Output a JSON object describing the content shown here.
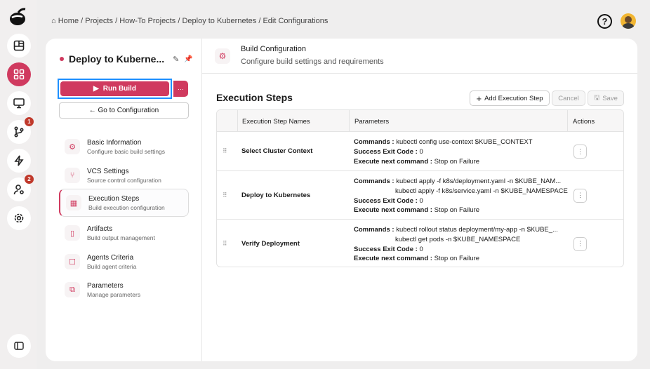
{
  "breadcrumb": {
    "items": [
      "Home",
      "Projects",
      "How-To Projects",
      "Deploy to Kubernetes",
      "Edit Configurations"
    ],
    "separator": "/"
  },
  "rail": {
    "badges": {
      "vcs": "1",
      "users": "2"
    }
  },
  "project": {
    "title": "Deploy to Kuberne...",
    "run_label": "Run Build",
    "more_label": "···",
    "goto_label": "← Go to Configuration"
  },
  "nav": [
    {
      "title": "Basic Information",
      "subtitle": "Configure basic build settings",
      "icon": "gear-icon"
    },
    {
      "title": "VCS Settings",
      "subtitle": "Source control configuration",
      "icon": "branch-icon"
    },
    {
      "title": "Execution Steps",
      "subtitle": "Build execution configuration",
      "icon": "blocks-icon",
      "active": true
    },
    {
      "title": "Artifacts",
      "subtitle": "Build output management",
      "icon": "file-icon"
    },
    {
      "title": "Agents Criteria",
      "subtitle": "Build agent criteria",
      "icon": "agent-icon"
    },
    {
      "title": "Parameters",
      "subtitle": "Manage parameters",
      "icon": "sliders-icon"
    }
  ],
  "header": {
    "title": "Build Configuration",
    "subtitle": "Configure build settings and requirements"
  },
  "section": {
    "title": "Execution Steps",
    "add_label": "Add Execution Step",
    "cancel_label": "Cancel",
    "save_label": "Save"
  },
  "table": {
    "columns": [
      "Execution Step Names",
      "Parameters",
      "Actions"
    ],
    "labels": {
      "commands": "Commands :",
      "exit": "Success Exit Code :",
      "next": "Execute next command :"
    },
    "rows": [
      {
        "name": "Select Cluster Context",
        "commands": [
          "kubectl config use-context $KUBE_CONTEXT"
        ],
        "exit_code": "0",
        "next": "Stop on Failure"
      },
      {
        "name": "Deploy to Kubernetes",
        "commands": [
          "kubectl apply -f k8s/deployment.yaml -n $KUBE_NAM...",
          "kubectl apply -f k8s/service.yaml -n $KUBE_NAMESPACE"
        ],
        "exit_code": "0",
        "next": "Stop on Failure"
      },
      {
        "name": "Verify Deployment",
        "commands": [
          "kubectl rollout status deployment/my-app -n $KUBE_...",
          "kubectl get pods -n $KUBE_NAMESPACE"
        ],
        "exit_code": "0",
        "next": "Stop on Failure"
      }
    ]
  },
  "colors": {
    "accent": "#d03a5f",
    "focus": "#1e90ff"
  }
}
